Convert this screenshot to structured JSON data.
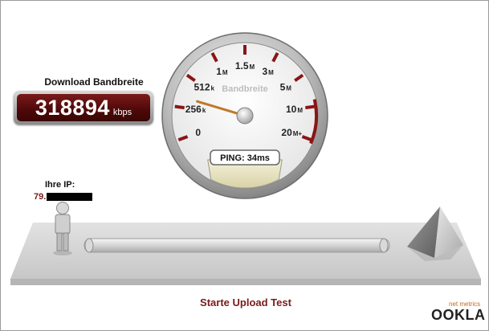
{
  "download": {
    "label": "Download Bandbreite",
    "value": "318894",
    "unit": "kbps"
  },
  "gauge": {
    "center_label": "Bandbreite",
    "ticks": [
      "0",
      "256k",
      "512k",
      "1M",
      "1.5M",
      "3M",
      "5M",
      "10M",
      "20M+"
    ],
    "needle_tick": "256k",
    "ping_text": "PING: 34ms"
  },
  "ip": {
    "label": "Ihre IP:",
    "value": "79."
  },
  "actions": {
    "upload_label": "Starte Upload Test"
  },
  "logo": {
    "subtitle": "net metrics",
    "name": "OOKLA"
  },
  "colors": {
    "accent": "#7a1a1a",
    "brand": "#c66a1a"
  }
}
